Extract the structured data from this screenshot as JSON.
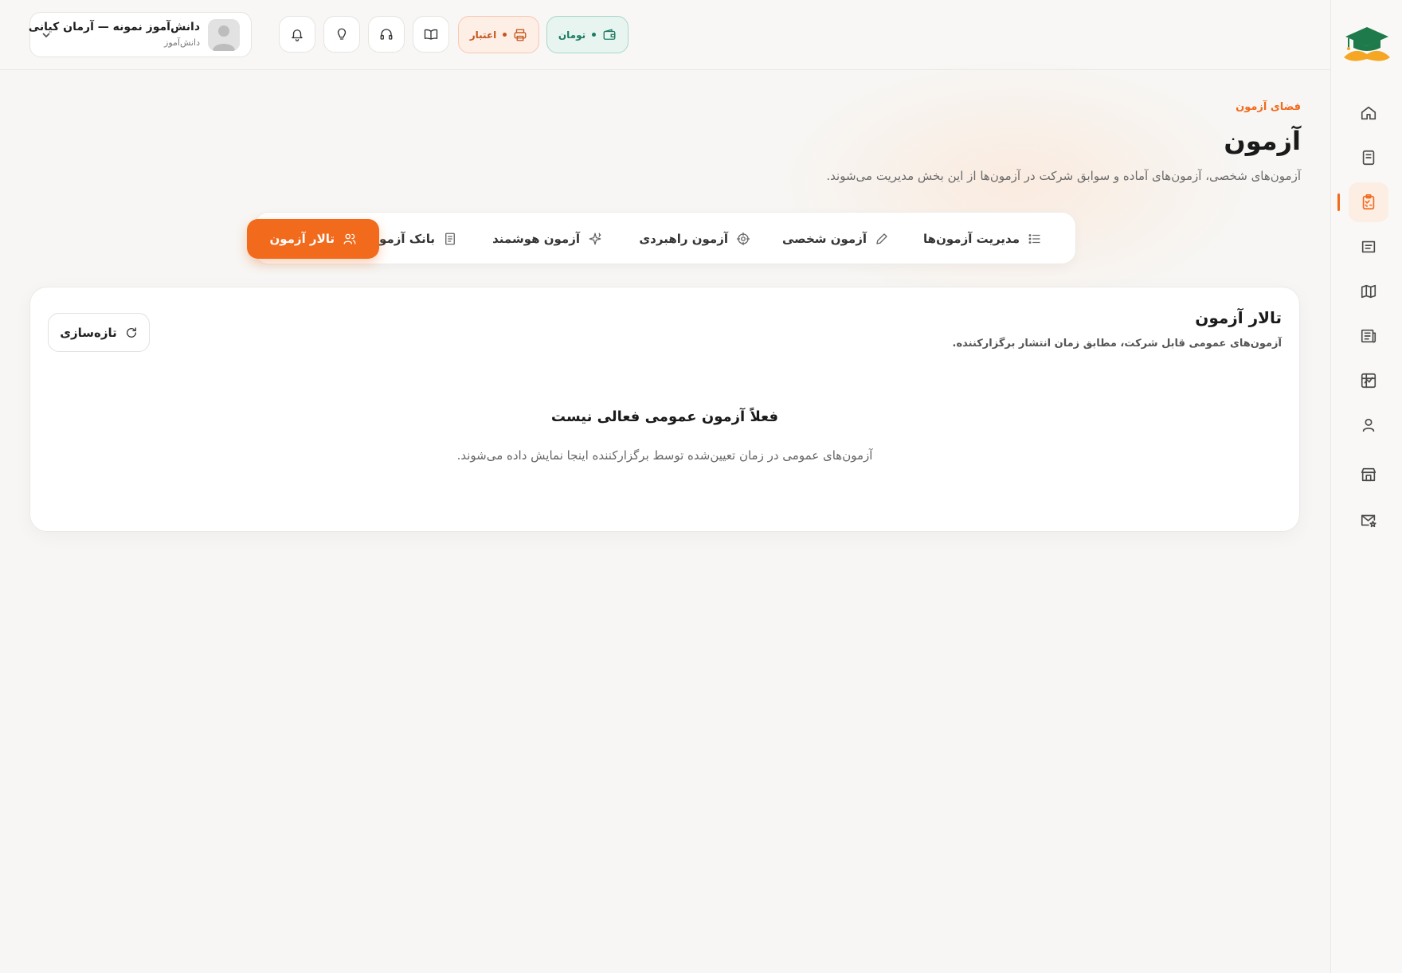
{
  "header": {
    "user": {
      "name": "دانش‌آموز نمونه — آرمان کیانی",
      "role": "دانش‌آموز"
    },
    "credit_label": "اعتبار",
    "toman_label": "تومان",
    "icons": [
      "notification-bell-icon",
      "lightbulb-icon",
      "headset-icon",
      "book-open-icon"
    ]
  },
  "sidebar": {
    "logo": "graduation-cap-mustache-logo",
    "items": [
      {
        "name": "home-icon",
        "active": false
      },
      {
        "name": "notebook-icon",
        "active": false
      },
      {
        "name": "clipboard-check-icon",
        "active": true
      },
      {
        "name": "document-icon",
        "active": false
      },
      {
        "name": "map-icon",
        "active": false
      },
      {
        "name": "article-icon",
        "active": false
      },
      {
        "name": "chart-grid-icon",
        "active": false
      },
      {
        "name": "user-icon",
        "active": false
      },
      {
        "name": "store-icon",
        "active": false
      },
      {
        "name": "mail-star-icon",
        "active": false
      }
    ]
  },
  "page": {
    "eyebrow": "فضای آزمون",
    "title": "آزمون",
    "description": "آزمون‌های شخصی، آزمون‌های آماده و سوابق شرکت در آزمون‌ها از این بخش مدیریت می‌شوند."
  },
  "tabs": [
    {
      "label": "مدیریت آزمون‌ها",
      "icon": "list-icon",
      "active": false
    },
    {
      "label": "آزمون شخصی",
      "icon": "pencil-icon",
      "active": false
    },
    {
      "label": "آزمون راهبردی",
      "icon": "crosshair-icon",
      "active": false
    },
    {
      "label": "آزمون هوشمند",
      "icon": "sparkle-icon",
      "active": false
    },
    {
      "label": "بانک آزمون",
      "icon": "book-icon",
      "active": false
    },
    {
      "label": "تالار آزمون",
      "icon": "users-icon",
      "active": true
    }
  ],
  "hall": {
    "title": "تالار آزمون",
    "subtitle": "آزمون‌های عمومی قابل شرکت، مطابق زمان انتشار برگزارکننده.",
    "refresh_label": "تازه‌سازی",
    "empty_title": "فعلاً آزمون عمومی فعالی نیست",
    "empty_desc": "آزمون‌های عمومی در زمان تعیین‌شده توسط برگزارکننده اینجا نمایش داده می‌شوند."
  },
  "colors": {
    "accent": "#f26a1b",
    "toman": "#1d7a62",
    "credit": "#c4561d"
  }
}
